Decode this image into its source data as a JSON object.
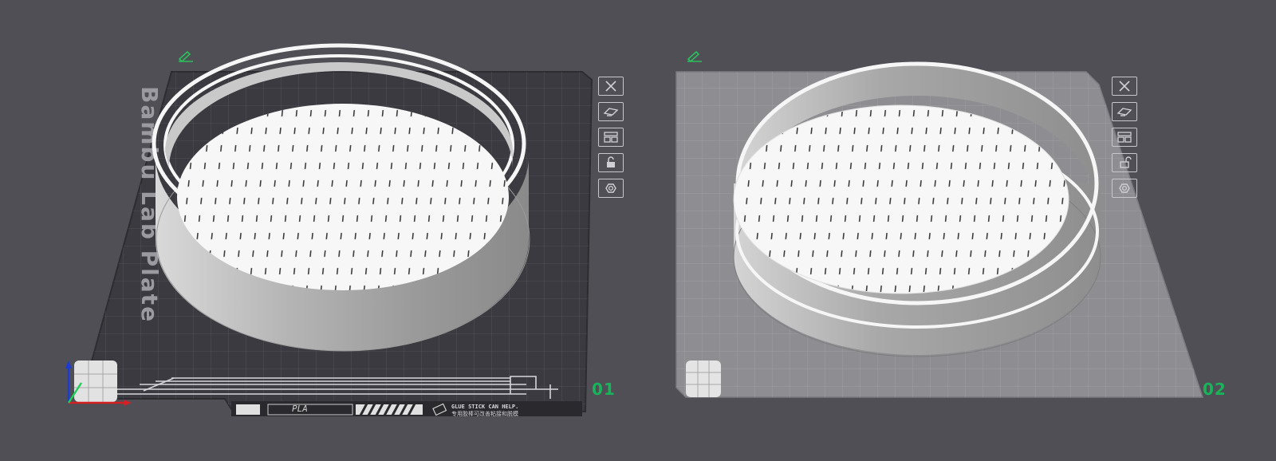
{
  "plates": [
    {
      "number": "01",
      "name": "Bambu Lab Plate",
      "filament_label": "PLA",
      "glue_hint_en": "GLUE STICK CAN HELP.",
      "glue_hint_cn": "专用胶棒可改善粘接和脱模",
      "state": "selected",
      "tools": [
        "close-icon",
        "auto-orient-icon",
        "arrange-icon",
        "lock-icon",
        "settings-icon"
      ]
    },
    {
      "number": "02",
      "state": "unselected",
      "tools": [
        "close-icon",
        "auto-orient-icon",
        "arrange-icon",
        "lock-icon",
        "settings-icon"
      ]
    }
  ],
  "colors": {
    "background": "#4f4f55",
    "plate_active": "#3a3a40",
    "plate_inactive": "#8a8a8f",
    "accent_green": "#19b35a",
    "model_face": "#f4f4f4",
    "model_side": "#a9a9a9"
  }
}
